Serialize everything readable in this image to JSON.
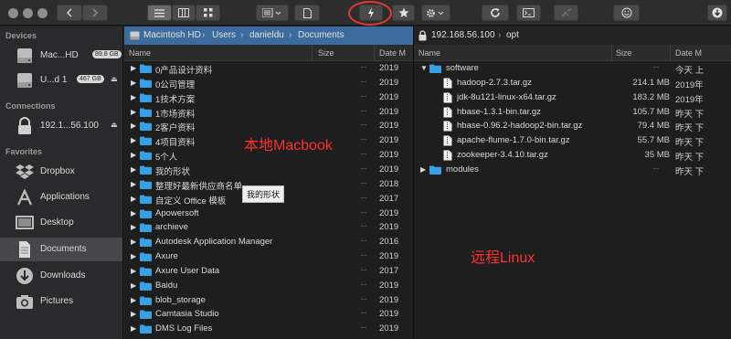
{
  "sidebar": {
    "sections": {
      "devices": "Devices",
      "connections": "Connections",
      "favorites": "Favorites"
    },
    "devices": [
      {
        "label": "Mac...HD",
        "badge": "89.8 GB"
      },
      {
        "label": "U...d 1",
        "badge": "467 GB"
      }
    ],
    "connections": [
      {
        "label": "192.1...56.100"
      }
    ],
    "favorites": [
      {
        "label": "Dropbox"
      },
      {
        "label": "Applications"
      },
      {
        "label": "Desktop"
      },
      {
        "label": "Documents",
        "selected": true
      },
      {
        "label": "Downloads"
      },
      {
        "label": "Pictures"
      }
    ]
  },
  "left_pane": {
    "breadcrumb": [
      "Macintosh HD",
      "Users",
      "danieldu",
      "Documents"
    ],
    "columns": {
      "name": "Name",
      "size": "Size",
      "date": "Date M"
    },
    "dash": "--",
    "rows": [
      {
        "name": "0产品设计资料",
        "date": "2019"
      },
      {
        "name": "0公司管理",
        "date": "2019"
      },
      {
        "name": "1技术方案",
        "date": "2019"
      },
      {
        "name": "1市场资料",
        "date": "2019"
      },
      {
        "name": "2客户资料",
        "date": "2019"
      },
      {
        "name": "4项目资料",
        "date": "2019"
      },
      {
        "name": "5个人",
        "date": "2019"
      },
      {
        "name": "我的形状",
        "date": "2019"
      },
      {
        "name": "整理好最新供应商名单",
        "date": "2018"
      },
      {
        "name": "自定义 Office 模板",
        "date": "2017"
      },
      {
        "name": "Apowersoft",
        "date": "2019"
      },
      {
        "name": "archieve",
        "date": "2019"
      },
      {
        "name": "Autodesk Application Manager",
        "date": "2016"
      },
      {
        "name": "Axure",
        "date": "2019"
      },
      {
        "name": "Axure User Data",
        "date": "2017"
      },
      {
        "name": "Baidu",
        "date": "2019"
      },
      {
        "name": "blob_storage",
        "date": "2019"
      },
      {
        "name": "Camtasia Studio",
        "date": "2019"
      },
      {
        "name": "DMS Log Files",
        "date": "2019"
      }
    ],
    "tooltip": "我的形状",
    "annotation": "本地Macbook"
  },
  "right_pane": {
    "path_host": "192.168.56.100",
    "path_sep": "›",
    "path_dir": "opt",
    "columns": {
      "name": "Name",
      "size": "Size",
      "date": "Date M"
    },
    "rows": [
      {
        "name": "software",
        "type": "folder",
        "expanded": true,
        "size": "--",
        "date": "今天 上"
      },
      {
        "name": "hadoop-2.7.3.tar.gz",
        "type": "file",
        "size": "214.1 MB",
        "date": "2019年"
      },
      {
        "name": "jdk-8u121-linux-x64.tar.gz",
        "type": "file",
        "size": "183.2 MB",
        "date": "2019年"
      },
      {
        "name": "hbase-1.3.1-bin.tar.gz",
        "type": "file",
        "size": "105.7 MB",
        "date": "昨天 下"
      },
      {
        "name": "hbase-0.96.2-hadoop2-bin.tar.gz",
        "type": "file",
        "size": "79.4 MB",
        "date": "昨天 下"
      },
      {
        "name": "apache-flume-1.7.0-bin.tar.gz",
        "type": "file",
        "size": "55.7 MB",
        "date": "昨天 下"
      },
      {
        "name": "zookeeper-3.4.10.tar.gz",
        "type": "file",
        "size": "35 MB",
        "date": "昨天 下"
      },
      {
        "name": "modules",
        "type": "folder",
        "expanded": false,
        "size": "--",
        "date": "昨天 下"
      }
    ],
    "annotation": "远程Linux"
  },
  "colors": {
    "folder": "#3aa0e6",
    "annotation": "#ff3030",
    "highlight_circle": "#e23b2e"
  }
}
